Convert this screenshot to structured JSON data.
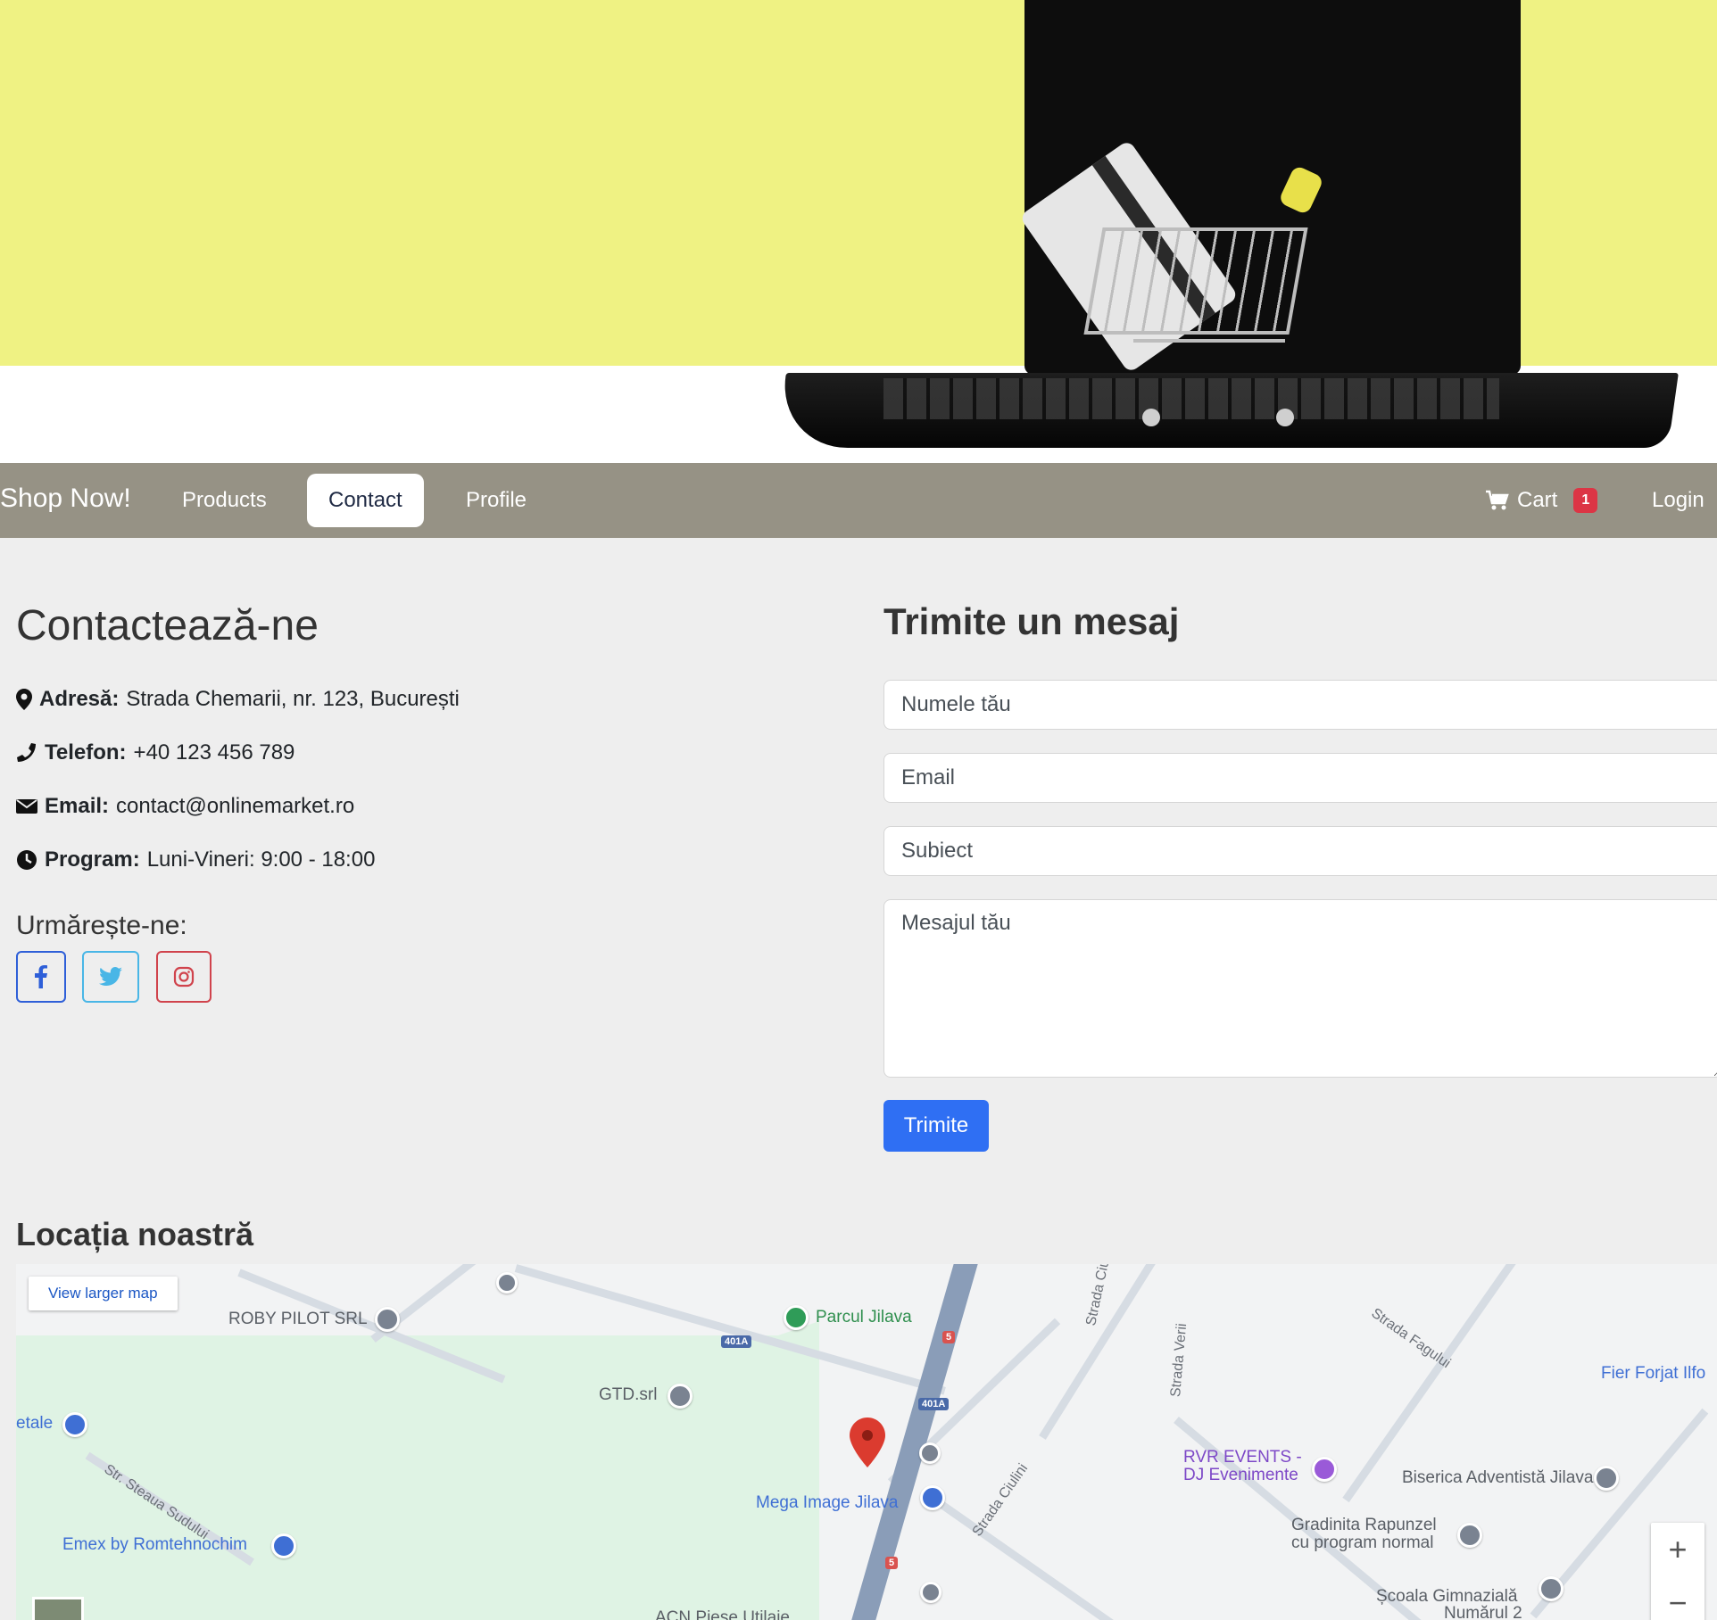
{
  "navbar": {
    "brand": "Shop Now!",
    "links": [
      "Products",
      "Contact",
      "Profile"
    ],
    "active": "Contact",
    "cart_label": "Cart",
    "cart_count": "1",
    "login": "Login"
  },
  "contact": {
    "title": "Contactează-ne",
    "address_label": "Adresă:",
    "address_value": "Strada Chemarii, nr. 123, București",
    "phone_label": "Telefon:",
    "phone_value": "+40 123 456 789",
    "email_label": "Email:",
    "email_value": "contact@onlinemarket.ro",
    "program_label": "Program:",
    "program_value": "Luni-Vineri: 9:00 - 18:00",
    "follow_title": "Urmărește-ne:"
  },
  "form": {
    "title": "Trimite un mesaj",
    "name_placeholder": "Numele tău",
    "email_placeholder": "Email",
    "subject_placeholder": "Subiect",
    "message_placeholder": "Mesajul tău",
    "submit_label": "Trimite"
  },
  "map": {
    "title": "Locația noastră",
    "larger_map": "View larger map",
    "places": {
      "roby": "ROBY PILOT SRL",
      "parcul": "Parcul Jilava",
      "gtd": "GTD.srl",
      "mega": "Mega Image Jilava",
      "etale": "etale",
      "emex": "Emex by Romtehnochim",
      "rvr1": "RVR EVENTS -",
      "rvr2": "DJ Evenimente",
      "biserica": "Biserica Adventistă Jilava",
      "fier": "Fier Forjat Ilfo",
      "gradinita1": "Gradinita Rapunzel",
      "gradinita2": "cu program normal",
      "scoala1": "Școala Gimnazială",
      "scoala2": "Numărul 2",
      "acn": "ACN Piese Utilaje"
    },
    "streets": {
      "ciulini1": "Strada Ciulini",
      "ciulini2": "Strada Ciulini",
      "verii": "Strada Verii",
      "fagului": "Strada Fagului",
      "steaua": "Str. Steaua Sudului"
    },
    "shields": {
      "s401a_1": "401A",
      "s401a_2": "401A",
      "s5_1": "5",
      "s5_2": "5"
    },
    "zoom_in": "+",
    "zoom_out": "−"
  }
}
